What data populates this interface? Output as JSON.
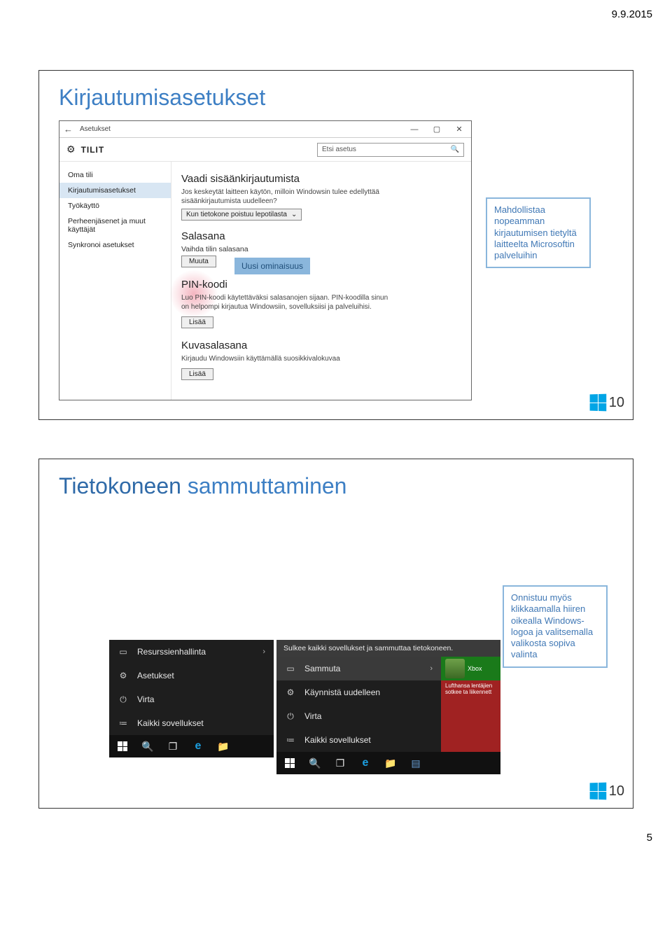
{
  "page": {
    "date": "9.9.2015",
    "number": "5"
  },
  "slide1": {
    "title": "Kirjautumisasetukset",
    "callout": "Mahdollistaa nopeamman kirjautumisen tietyltä laitteelta Microsoftin palveluihin",
    "uusi_label": "Uusi ominaisuus",
    "win10_text": "10",
    "window": {
      "back": "←",
      "topbar_title": "Asetukset",
      "min": "—",
      "max": "▢",
      "close": "✕",
      "header_title": "TILIT",
      "search_placeholder": "Etsi asetus",
      "search_icon": "🔍",
      "sidebar": [
        "Oma tili",
        "Kirjautumisasetukset",
        "Työkäyttö",
        "Perheenjäsenet ja muut käyttäjät",
        "Synkronoi asetukset"
      ],
      "section_require_heading": "Vaadi sisäänkirjautumista",
      "section_require_desc": "Jos keskeytät laitteen käytön, milloin Windowsin tulee edellyttää sisäänkirjautumista uudelleen?",
      "require_select": "Kun tietokone poistuu lepotilasta",
      "section_pwd_heading": "Salasana",
      "section_pwd_sub": "Vaihda tilin salasana",
      "btn_change": "Muuta",
      "section_pin_heading": "PIN-koodi",
      "section_pin_desc": "Luo PIN-koodi käytettäväksi salasanojen sijaan. PIN-koodilla sinun on helpompi kirjautua Windowsiin, sovelluksiisi ja palveluihisi.",
      "btn_add": "Lisää",
      "section_pic_heading": "Kuvasalasana",
      "section_pic_desc": "Kirjaudu Windowsiin käyttämällä suosikkivalokuvaa",
      "btn_add2": "Lisää"
    }
  },
  "slide2": {
    "title_accent": "Tietokoneen",
    "title_rest": " sammuttaminen",
    "win10_text": "10",
    "callout": "Onnistuu myös klikkaamalla hiiren oikealla Windows-logoa ja valitsemalla valikosta sopiva valinta",
    "tooltip": "Sulkee kaikki sovellukset ja sammuttaa tietokoneen.",
    "panel_left": {
      "rows": [
        {
          "icon": "▭",
          "label": "Resurssienhallinta",
          "chev": "›"
        },
        {
          "icon": "⚙",
          "label": "Asetukset",
          "chev": ""
        },
        {
          "icon": "⏻",
          "label": "Virta",
          "chev": ""
        },
        {
          "icon": "≔",
          "label": "Kaikki sovellukset",
          "chev": ""
        }
      ]
    },
    "panel_right": {
      "rows": [
        {
          "icon": "▭",
          "label": "Sammuta",
          "chev": "›"
        },
        {
          "icon": "⚙",
          "label": "Käynnistä uudelleen",
          "chev": ""
        },
        {
          "icon": "⏻",
          "label": "Virta",
          "chev": ""
        },
        {
          "icon": "≔",
          "label": "Kaikki sovellukset",
          "chev": ""
        }
      ]
    },
    "tiles": {
      "xbox": "Xbox",
      "red": "Lufthansa lentäjien sotkee ta liikennett"
    },
    "taskbar": {
      "search": "🔍",
      "taskview": "❐",
      "folder": "📁",
      "note": "▤"
    }
  }
}
